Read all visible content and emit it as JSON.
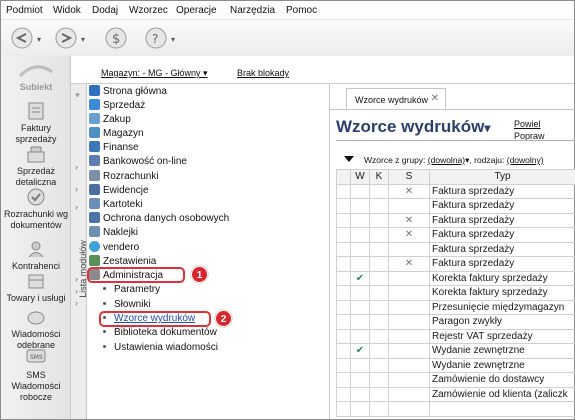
{
  "menu": [
    "Podmiot",
    "Widok",
    "Dodaj",
    "Wzorzec",
    "Operacje",
    "Narzędzia",
    "Pomoc"
  ],
  "app": {
    "logo_text": "Subiekt"
  },
  "left_nav": [
    {
      "label": "Faktury sprzedaży",
      "icon": "invoice-icon"
    },
    {
      "label": "Sprzedaż detaliczna",
      "icon": "cash-register-icon"
    },
    {
      "label": "Rozrachunki wg dokumentów",
      "icon": "settlements-icon"
    },
    {
      "label": "Kontrahenci",
      "icon": "contractors-icon"
    },
    {
      "label": "Towary i usługi",
      "icon": "products-icon"
    },
    {
      "label": "Wiadomości odebrane",
      "icon": "inbox-icon"
    },
    {
      "label": "SMS Wiadomości robocze",
      "icon": "sms-icon"
    }
  ],
  "topbar": {
    "warehouse": "Magazyn: - MG - Główny ▾",
    "lock": "Brak blokady"
  },
  "strip_label": "Lista modułów",
  "tree": {
    "top_items": [
      {
        "label": "Strona główna",
        "color": "#2f6fbf"
      },
      {
        "label": "Sprzedaż",
        "color": "#3a8ad6"
      },
      {
        "label": "Zakup",
        "color": "#6aa0d0"
      },
      {
        "label": "Magazyn",
        "color": "#4f8fc4"
      },
      {
        "label": "Finanse",
        "color": "#3b78b8"
      },
      {
        "label": "Bankowość on-line",
        "color": "#5b7fae"
      },
      {
        "label": "Rozrachunki",
        "color": "#7a8fa8"
      },
      {
        "label": "Ewidencje",
        "color": "#4a6f9f"
      },
      {
        "label": "Kartoteki",
        "color": "#6c8fb8"
      },
      {
        "label": "Ochrona danych osobowych",
        "color": "#4c74a8"
      },
      {
        "label": "Naklejki",
        "color": "#6f8fb0"
      },
      {
        "label": "vendero",
        "color": "#3fa0d8"
      },
      {
        "label": "Zestawienia",
        "color": "#5a8f5a"
      },
      {
        "label": "Administracja",
        "color": "#8a8a8a"
      }
    ],
    "admin_children": [
      "Parametry",
      "Słowniki",
      "Wzorce wydruków",
      "Biblioteka dokumentów",
      "Ustawienia wiadomości"
    ],
    "callouts": [
      "1",
      "2"
    ]
  },
  "content": {
    "tab_label": "Wzorce wydruków",
    "title": "Wzorce wydruków",
    "links": [
      "Powiel",
      "Popraw"
    ],
    "filter": {
      "label": "Wzorce z grupy:",
      "group_value": "(dowolna)",
      "kind_label": ", rodzaju:",
      "kind_value": "(dowolny)"
    },
    "columns": [
      "W",
      "K",
      "S",
      "Typ"
    ],
    "rows": [
      {
        "w": "",
        "k": "",
        "s": "✕",
        "typ": "Faktura sprzedaży"
      },
      {
        "w": "",
        "k": "",
        "s": "",
        "typ": "Faktura sprzedaży"
      },
      {
        "w": "",
        "k": "",
        "s": "✕",
        "typ": "Faktura sprzedaży"
      },
      {
        "w": "",
        "k": "",
        "s": "✕",
        "typ": "Faktura sprzedaży"
      },
      {
        "w": "",
        "k": "",
        "s": "",
        "typ": "Faktura sprzedaży"
      },
      {
        "w": "",
        "k": "",
        "s": "✕",
        "typ": "Faktura sprzedaży"
      },
      {
        "w": "✔",
        "k": "",
        "s": "",
        "typ": "Korekta faktury sprzedaży"
      },
      {
        "w": "",
        "k": "",
        "s": "",
        "typ": "Korekta faktury sprzedaży"
      },
      {
        "w": "",
        "k": "",
        "s": "",
        "typ": "Przesunięcie międzymagazyn"
      },
      {
        "w": "",
        "k": "",
        "s": "",
        "typ": "Paragon zwykły"
      },
      {
        "w": "",
        "k": "",
        "s": "",
        "typ": "Rejestr VAT sprzedaży"
      },
      {
        "w": "✔",
        "k": "",
        "s": "",
        "typ": "Wydanie zewnętrzne"
      },
      {
        "w": "",
        "k": "",
        "s": "",
        "typ": "Wydanie zewnętrzne"
      },
      {
        "w": "",
        "k": "",
        "s": "",
        "typ": "Zamówienie do dostawcy"
      },
      {
        "w": "",
        "k": "",
        "s": "",
        "typ": "Zamówienie od klienta (zaliczk"
      },
      {
        "w": "",
        "k": "",
        "s": "",
        "typ": ""
      }
    ]
  }
}
